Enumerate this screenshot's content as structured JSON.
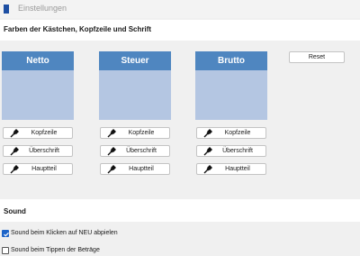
{
  "window": {
    "title": "Einstellungen"
  },
  "colors_section": {
    "title": "Farben der Kästchen, Kopfzeile und Schrift",
    "reset_label": "Reset",
    "columns": [
      {
        "header": "Netto",
        "header_color": "#4f86c0",
        "body_color": "#b4c6e2",
        "buttons": [
          "Kopfzeile",
          "Überschrift",
          "Hauptteil"
        ]
      },
      {
        "header": "Steuer",
        "header_color": "#4f86c0",
        "body_color": "#b4c6e2",
        "buttons": [
          "Kopfzeile",
          "Überschrift",
          "Hauptteil"
        ]
      },
      {
        "header": "Brutto",
        "header_color": "#4f86c0",
        "body_color": "#b4c6e2",
        "buttons": [
          "Kopfzeile",
          "Überschrift",
          "Hauptteil"
        ]
      }
    ]
  },
  "sound_section": {
    "title": "Sound",
    "options": [
      {
        "label": "Sound beim Klicken auf NEU abpielen",
        "checked": true
      },
      {
        "label": "Sound beim Tippen der Beträge",
        "checked": false
      }
    ]
  },
  "icons": {
    "picker": "eyedropper-icon",
    "check": "checkmark-icon"
  },
  "colors": {
    "accent": "#4f86c0",
    "checkbox_accent": "#1d64c8"
  }
}
